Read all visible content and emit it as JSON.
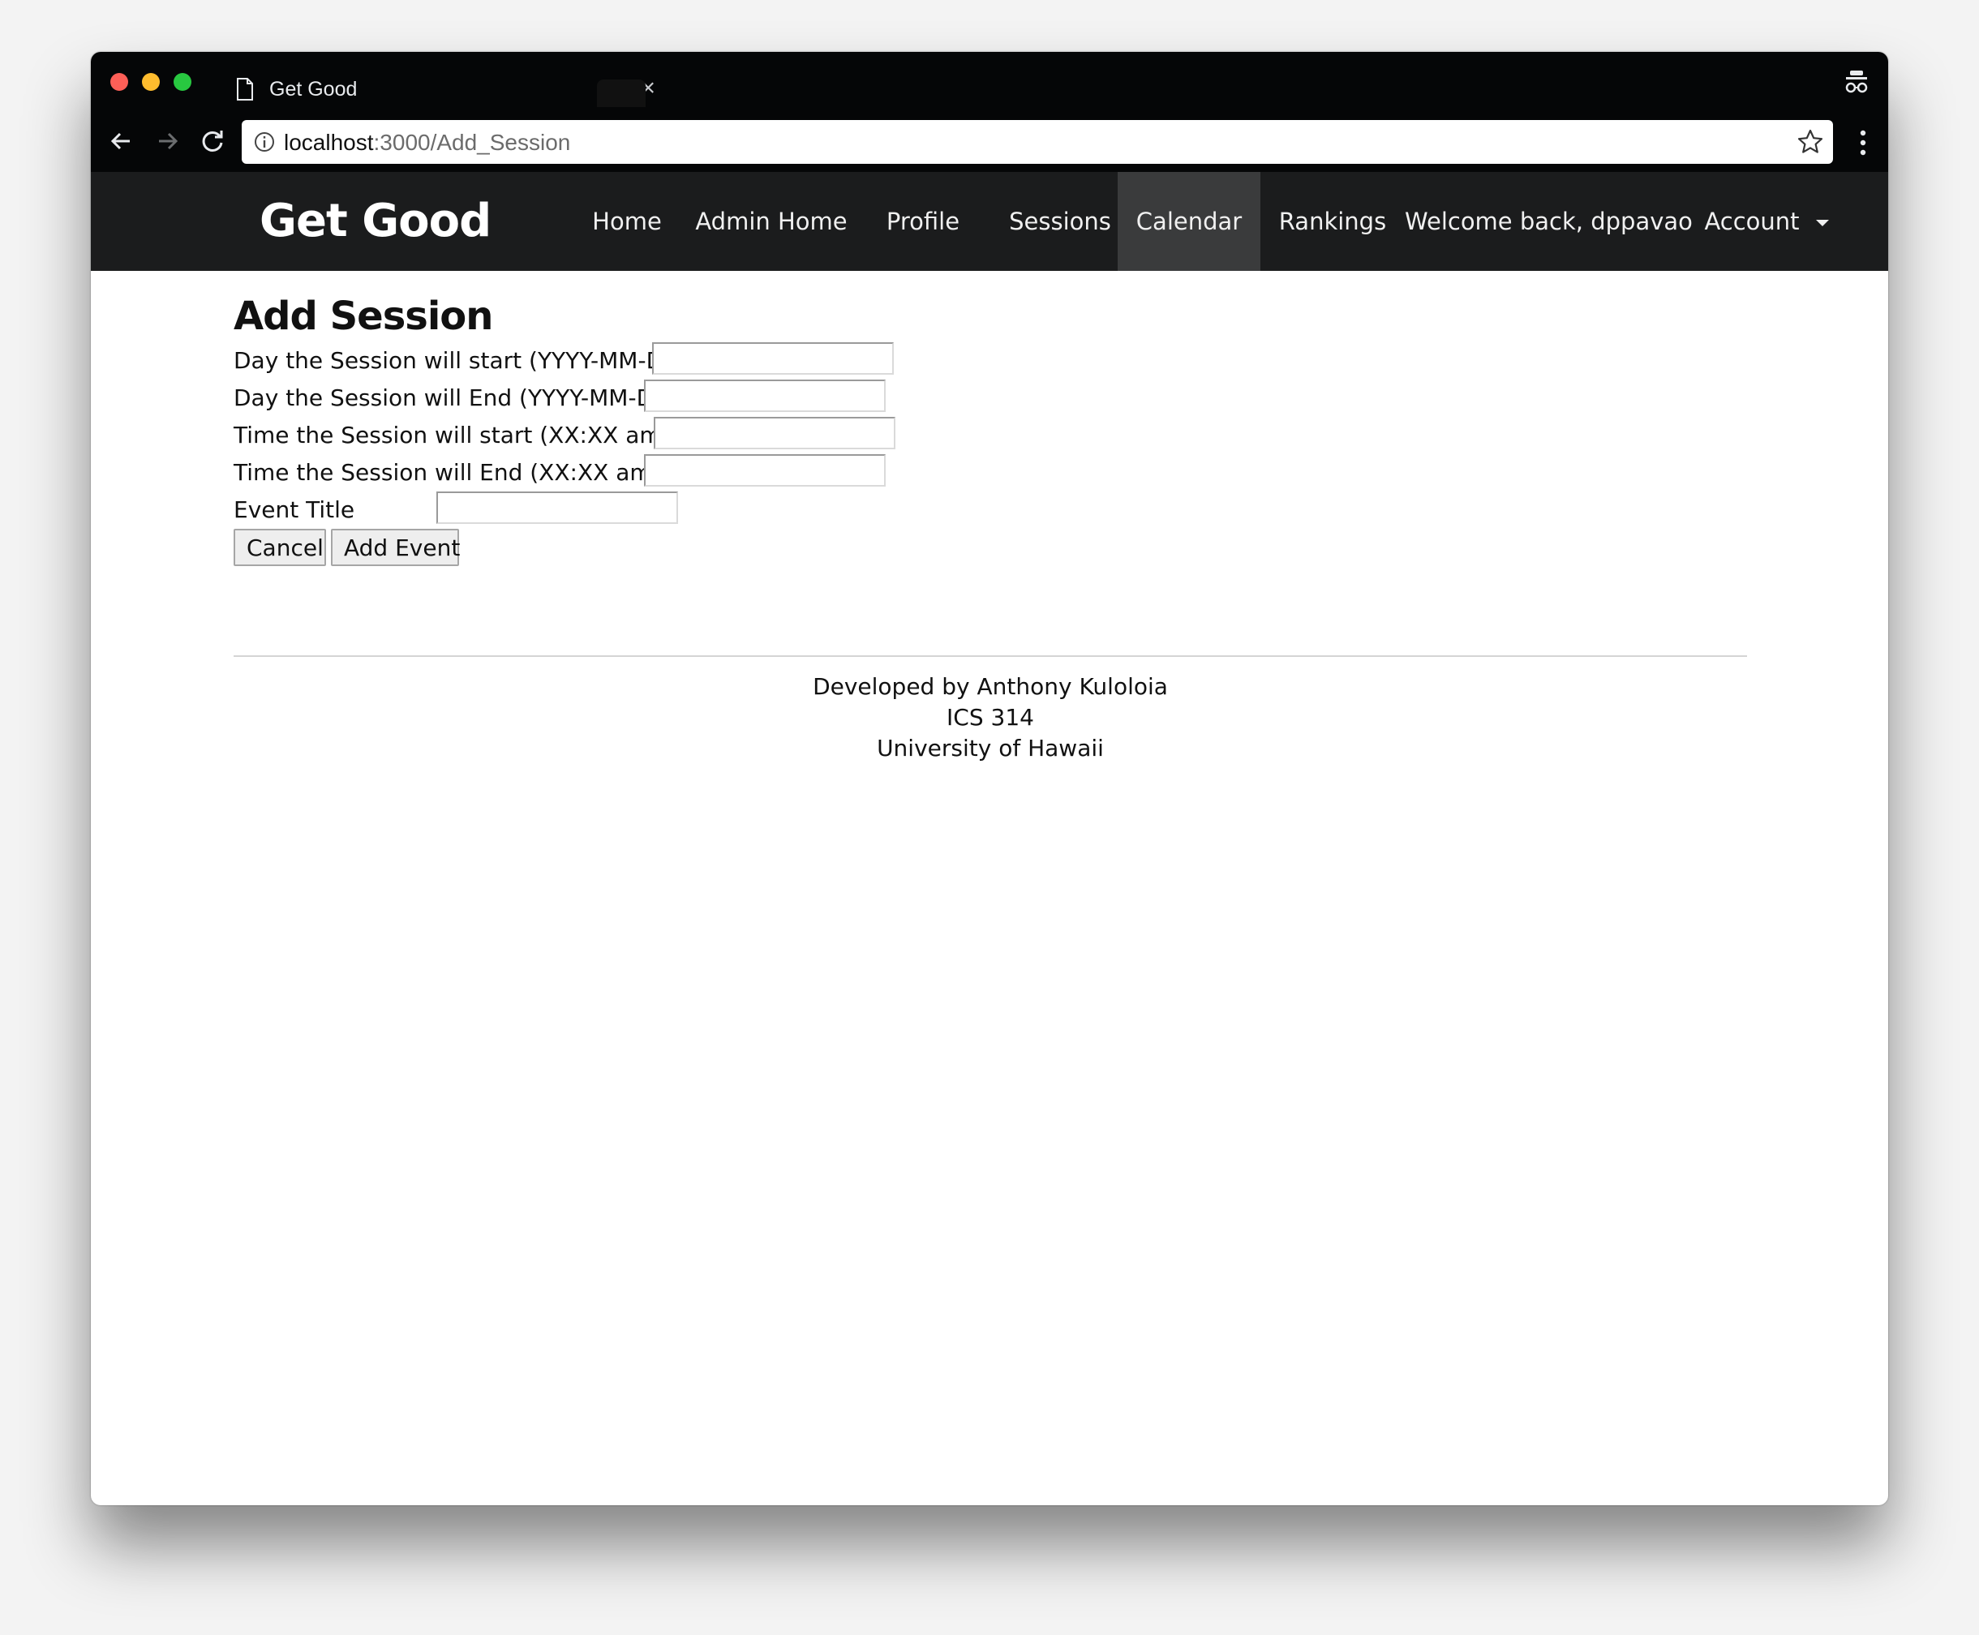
{
  "browser": {
    "tab_title": "Get Good",
    "tab_close": "×",
    "url_host": "localhost",
    "url_path": ":3000/Add_Session"
  },
  "navbar": {
    "brand": "Get Good",
    "items": [
      {
        "label": "Home",
        "active": false
      },
      {
        "label": "Admin Home",
        "active": false
      },
      {
        "label": "Profile",
        "active": false
      },
      {
        "label": "Sessions",
        "active": false
      },
      {
        "label": "Calendar",
        "active": true
      },
      {
        "label": "Rankings",
        "active": false
      },
      {
        "label": "Welcome back, dppavao",
        "active": false
      },
      {
        "label": "Account",
        "active": false
      }
    ]
  },
  "form": {
    "title": "Add Session",
    "fields": [
      {
        "label": "Day the Session will start (YYYY-MM-DD)",
        "value": ""
      },
      {
        "label": "Day the Session will End (YYYY-MM-DD)",
        "value": ""
      },
      {
        "label": "Time the Session will start (XX:XX am/pm)",
        "value": ""
      },
      {
        "label": "Time the Session will End (XX:XX am/pm)",
        "value": ""
      },
      {
        "label": "Event Title",
        "value": ""
      }
    ],
    "cancel_label": "Cancel",
    "submit_label": "Add Event"
  },
  "footer": {
    "line1": "Developed by Anthony Kuloloia",
    "line2": "ICS 314",
    "line3": "University of Hawaii"
  },
  "colors": {
    "navbar_bg": "#1b1c1d",
    "navbar_active_bg": "#3a3b3c",
    "chrome_bg": "#050607"
  }
}
